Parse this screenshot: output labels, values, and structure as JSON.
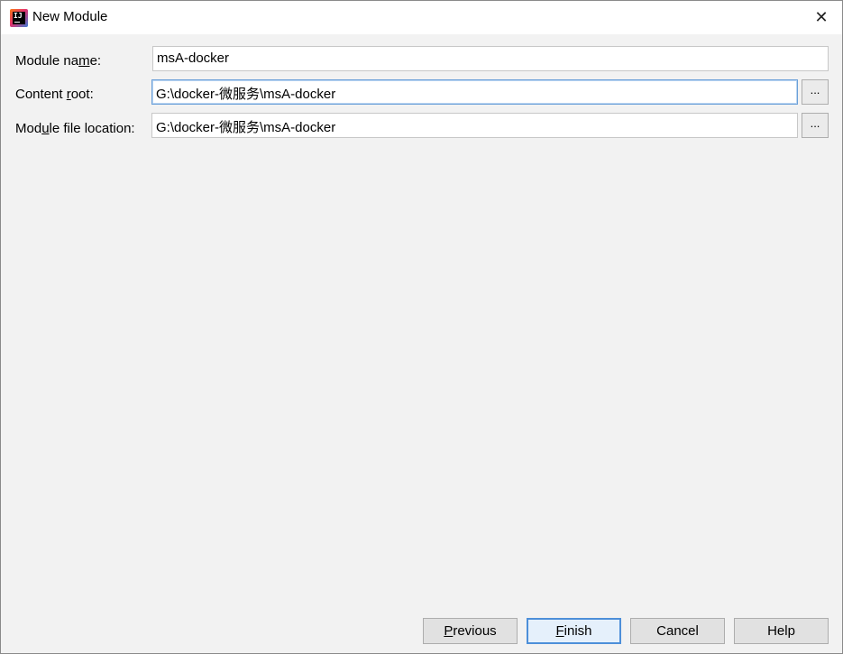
{
  "window": {
    "title": "New Module",
    "close_glyph": "✕"
  },
  "form": {
    "module_name": {
      "label_pre": "Module na",
      "label_mnemonic": "m",
      "label_post": "e:",
      "value": "msA-docker"
    },
    "content_root": {
      "label_pre": "Content ",
      "label_mnemonic": "r",
      "label_post": "oot:",
      "value": "G:\\docker-微服务\\msA-docker",
      "browse_label": "..."
    },
    "module_file_location": {
      "label_pre": "Mod",
      "label_mnemonic": "u",
      "label_post": "le file location:",
      "value": "G:\\docker-微服务\\msA-docker",
      "browse_label": "..."
    }
  },
  "buttons": {
    "previous": {
      "mnemonic": "P",
      "rest": "revious"
    },
    "finish": {
      "mnemonic": "F",
      "rest": "inish"
    },
    "cancel": {
      "label": "Cancel"
    },
    "help": {
      "label": "Help"
    }
  },
  "icons": {
    "app": "intellij-idea-icon",
    "close": "close-icon"
  },
  "colors": {
    "focus_border": "#6a9fd8",
    "default_button_border": "#4d8fd9"
  }
}
